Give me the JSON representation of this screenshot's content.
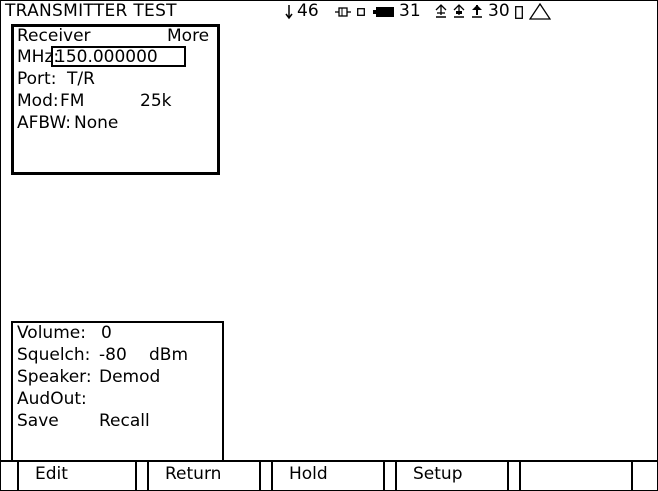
{
  "header": {
    "title": "TRANSMITTER TEST",
    "signal_value": "46",
    "battery_value": "31",
    "temp_value": "30"
  },
  "receiver_panel": {
    "label": "Receiver",
    "more_label": "More",
    "mhz_label": "MHz:",
    "frequency": "150.000000",
    "port_label": "Port:",
    "port_value": "T/R",
    "mod_label": "Mod:",
    "mod_value": "FM",
    "bandwidth": "25k",
    "afbw_label": "AFBW:",
    "afbw_value": "None"
  },
  "audio_panel": {
    "volume_label": "Volume:",
    "volume_value": "0",
    "squelch_label": "Squelch:",
    "squelch_value": "-80",
    "squelch_unit": "dBm",
    "speaker_label": "Speaker:",
    "speaker_value": "Demod",
    "audout_label": "AudOut:",
    "save_label": "Save",
    "recall_label": "Recall"
  },
  "softkeys": [
    "Edit",
    "Return",
    "Hold",
    "Setup",
    ""
  ]
}
